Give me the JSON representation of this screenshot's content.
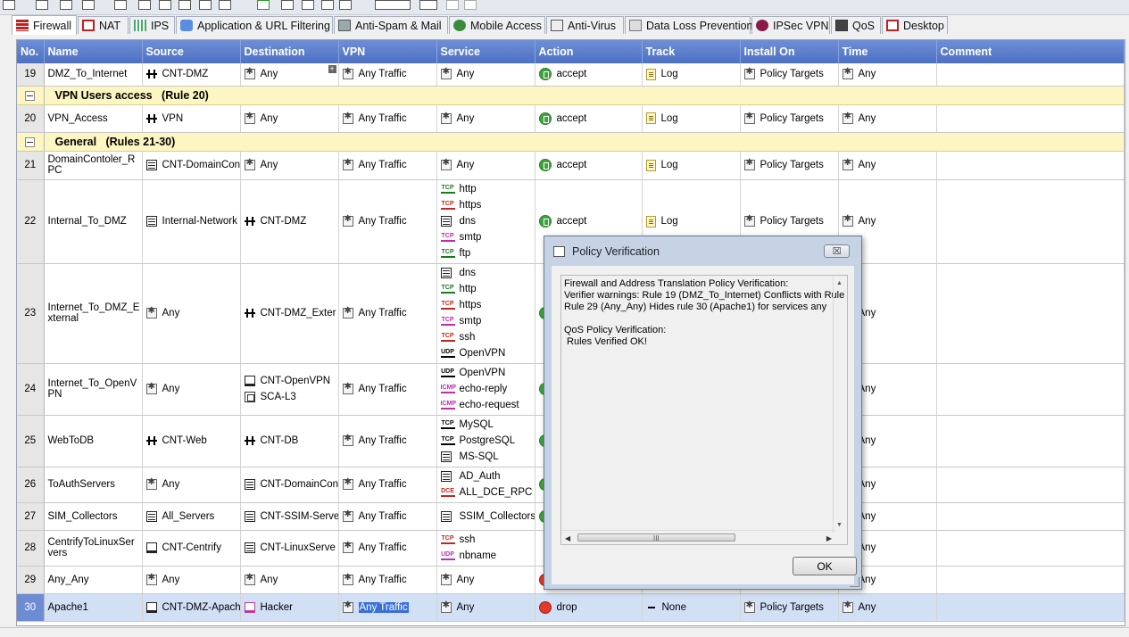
{
  "tabs": [
    {
      "label": "Firewall",
      "icon": "firewall-icon"
    },
    {
      "label": "NAT",
      "icon": "nat-icon"
    },
    {
      "label": "IPS",
      "icon": "ips-icon"
    },
    {
      "label": "Application & URL Filtering",
      "icon": "application-icon"
    },
    {
      "label": "Anti-Spam & Mail",
      "icon": "mail-icon"
    },
    {
      "label": "Mobile Access",
      "icon": "mobile-access-icon"
    },
    {
      "label": "Anti-Virus",
      "icon": "anti-virus-icon"
    },
    {
      "label": "Data Loss Prevention",
      "icon": "dlp-icon"
    },
    {
      "label": "IPSec VPN",
      "icon": "ipsec-vpn-icon"
    },
    {
      "label": "QoS",
      "icon": "qos-icon"
    },
    {
      "label": "Desktop",
      "icon": "desktop-icon"
    }
  ],
  "columns": [
    "No.",
    "Name",
    "Source",
    "Destination",
    "VPN",
    "Service",
    "Action",
    "Track",
    "Install On",
    "Time",
    "Comment"
  ],
  "sections": {
    "vpn_users": "VPN Users access",
    "vpn_users_rules": "(Rule 20)",
    "general": "General",
    "general_rules": "(Rules 21-30)"
  },
  "rules": {
    "r19": {
      "no": "19",
      "name": "DMZ_To_Internet",
      "source": "CNT-DMZ",
      "destination": "Any",
      "vpn": "Any Traffic",
      "service": [
        "Any"
      ],
      "action": "accept",
      "track": "Log",
      "install_on": "Policy Targets",
      "time": "Any"
    },
    "r20": {
      "no": "20",
      "name": "VPN_Access",
      "source": "VPN",
      "destination": "Any",
      "vpn": "Any Traffic",
      "service": [
        "Any"
      ],
      "action": "accept",
      "track": "Log",
      "install_on": "Policy Targets",
      "time": "Any"
    },
    "r21": {
      "no": "21",
      "name": [
        "DomainContoler_R",
        "PC"
      ],
      "source": "CNT-DomainCon",
      "destination": "Any",
      "vpn": "Any Traffic",
      "service": [
        "Any"
      ],
      "action": "accept",
      "track": "Log",
      "install_on": "Policy Targets",
      "time": "Any"
    },
    "r22": {
      "no": "22",
      "name": "Internal_To_DMZ",
      "source": "Internal-Network",
      "destination": "CNT-DMZ",
      "vpn": "Any Traffic",
      "service": [
        "http",
        "https",
        "dns",
        "smtp",
        "ftp"
      ],
      "action": "accept",
      "track": "Log",
      "install_on": "Policy Targets",
      "time": "Any"
    },
    "r23": {
      "no": "23",
      "name": [
        "Internet_To_DMZ_E",
        "xternal"
      ],
      "source": "Any",
      "destination": "CNT-DMZ_Exter",
      "vpn": "Any Traffic",
      "service": [
        "dns",
        "http",
        "https",
        "smtp",
        "ssh",
        "OpenVPN"
      ],
      "time": "Any"
    },
    "r24": {
      "no": "24",
      "name": [
        "Internet_To_OpenV",
        "PN"
      ],
      "source": "Any",
      "destination": [
        "CNT-OpenVPN",
        "SCA-L3"
      ],
      "vpn": "Any Traffic",
      "service": [
        "OpenVPN",
        "echo-reply",
        "echo-request"
      ],
      "time": "Any"
    },
    "r25": {
      "no": "25",
      "name": "WebToDB",
      "source": "CNT-Web",
      "destination": "CNT-DB",
      "vpn": "Any Traffic",
      "service": [
        "MySQL",
        "PostgreSQL",
        "MS-SQL"
      ],
      "time": "Any"
    },
    "r26": {
      "no": "26",
      "name": "ToAuthServers",
      "source": "Any",
      "destination": "CNT-DomainCon",
      "vpn": "Any Traffic",
      "service": [
        "AD_Auth",
        "ALL_DCE_RPC"
      ],
      "time": "Any"
    },
    "r27": {
      "no": "27",
      "name": "SIM_Collectors",
      "source": "All_Servers",
      "destination": "CNT-SSIM-Serve",
      "vpn": "Any Traffic",
      "service": [
        "SSIM_Collectors"
      ],
      "time": "Any"
    },
    "r28": {
      "no": "28",
      "name": [
        "CentrifyToLinuxSer",
        "vers"
      ],
      "source": "CNT-Centrify",
      "destination": "CNT-LinuxServe",
      "vpn": "Any Traffic",
      "service": [
        "ssh",
        "nbname"
      ],
      "time": "Any"
    },
    "r29": {
      "no": "29",
      "name": "Any_Any",
      "source": "Any",
      "destination": "Any",
      "vpn": "Any Traffic",
      "service": [
        "Any"
      ],
      "time": "Any"
    },
    "r30": {
      "no": "30",
      "name": "Apache1",
      "source": "CNT-DMZ-Apach",
      "destination": "Hacker",
      "vpn": "Any Traffic",
      "service": [
        "Any"
      ],
      "action": "drop",
      "track": "None",
      "install_on": "Policy Targets",
      "time": "Any"
    }
  },
  "dialog": {
    "title": "Policy Verification",
    "close_label": "☒",
    "lines": [
      "Firewall and Address Translation Policy Verification:",
      "Verifier warnings: Rule 19 (DMZ_To_Internet) Conflicts with Rule",
      "Rule 29 (Any_Any) Hides rule 30 (Apache1) for services any",
      "",
      "QoS Policy Verification:",
      " Rules Verified OK!"
    ],
    "ok_label": "OK",
    "scroll_thumb": "III"
  },
  "colors": {
    "header_blue": "#5677c9",
    "section_yellow": "#fdf5c2",
    "accept_green": "#3ea43e",
    "drop_red": "#e23a2a",
    "selected_row": "#d2e0f6"
  }
}
